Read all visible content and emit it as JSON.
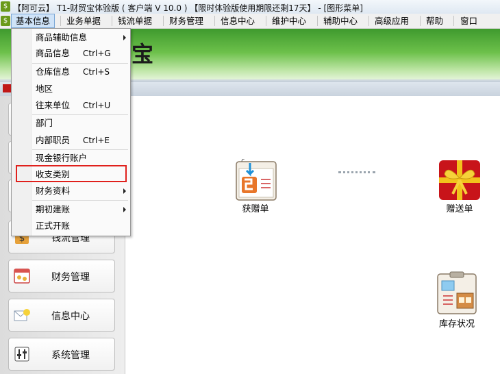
{
  "window": {
    "title": "【阿可云】 T1-财贸宝体验版 ( 客户端 V 10.0 ) 【限时体验版使用期限还剩17天】 - [图形菜单]"
  },
  "menubar": {
    "items": [
      "基本信息",
      "业务单据",
      "钱流单据",
      "财务管理",
      "信息中心",
      "维护中心",
      "辅助中心",
      "高级应用",
      "帮助",
      "窗口"
    ]
  },
  "banner": {
    "logo_text": "宝"
  },
  "dropdown": {
    "items": [
      {
        "label": "商品辅助信息",
        "shortcut": "",
        "submenu": true
      },
      {
        "label": "商品信息",
        "shortcut": "Ctrl+G",
        "submenu": false
      },
      {
        "label": "仓库信息",
        "shortcut": "Ctrl+S",
        "submenu": false
      },
      {
        "label": "地区",
        "shortcut": "",
        "submenu": false
      },
      {
        "label": "往来单位",
        "shortcut": "Ctrl+U",
        "submenu": false
      },
      {
        "label": "部门",
        "shortcut": "",
        "submenu": false
      },
      {
        "label": "内部职员",
        "shortcut": "Ctrl+E",
        "submenu": false
      },
      {
        "label": "现金银行账户",
        "shortcut": "",
        "submenu": false
      },
      {
        "label": "收支类别",
        "shortcut": "",
        "submenu": false,
        "highlighted": true
      },
      {
        "label": "财务资料",
        "shortcut": "",
        "submenu": true
      },
      {
        "label": "期初建账",
        "shortcut": "",
        "submenu": true
      },
      {
        "label": "正式开账",
        "shortcut": "",
        "submenu": false
      }
    ]
  },
  "leftnav": {
    "items": [
      "钱流管理",
      "财务管理",
      "信息中心",
      "系统管理"
    ]
  },
  "content": {
    "tiles": [
      "获赠单",
      "赠送单",
      "库存状况"
    ]
  },
  "colors": {
    "highlight_box": "#e0201c",
    "banner_green": "#4aa836"
  }
}
